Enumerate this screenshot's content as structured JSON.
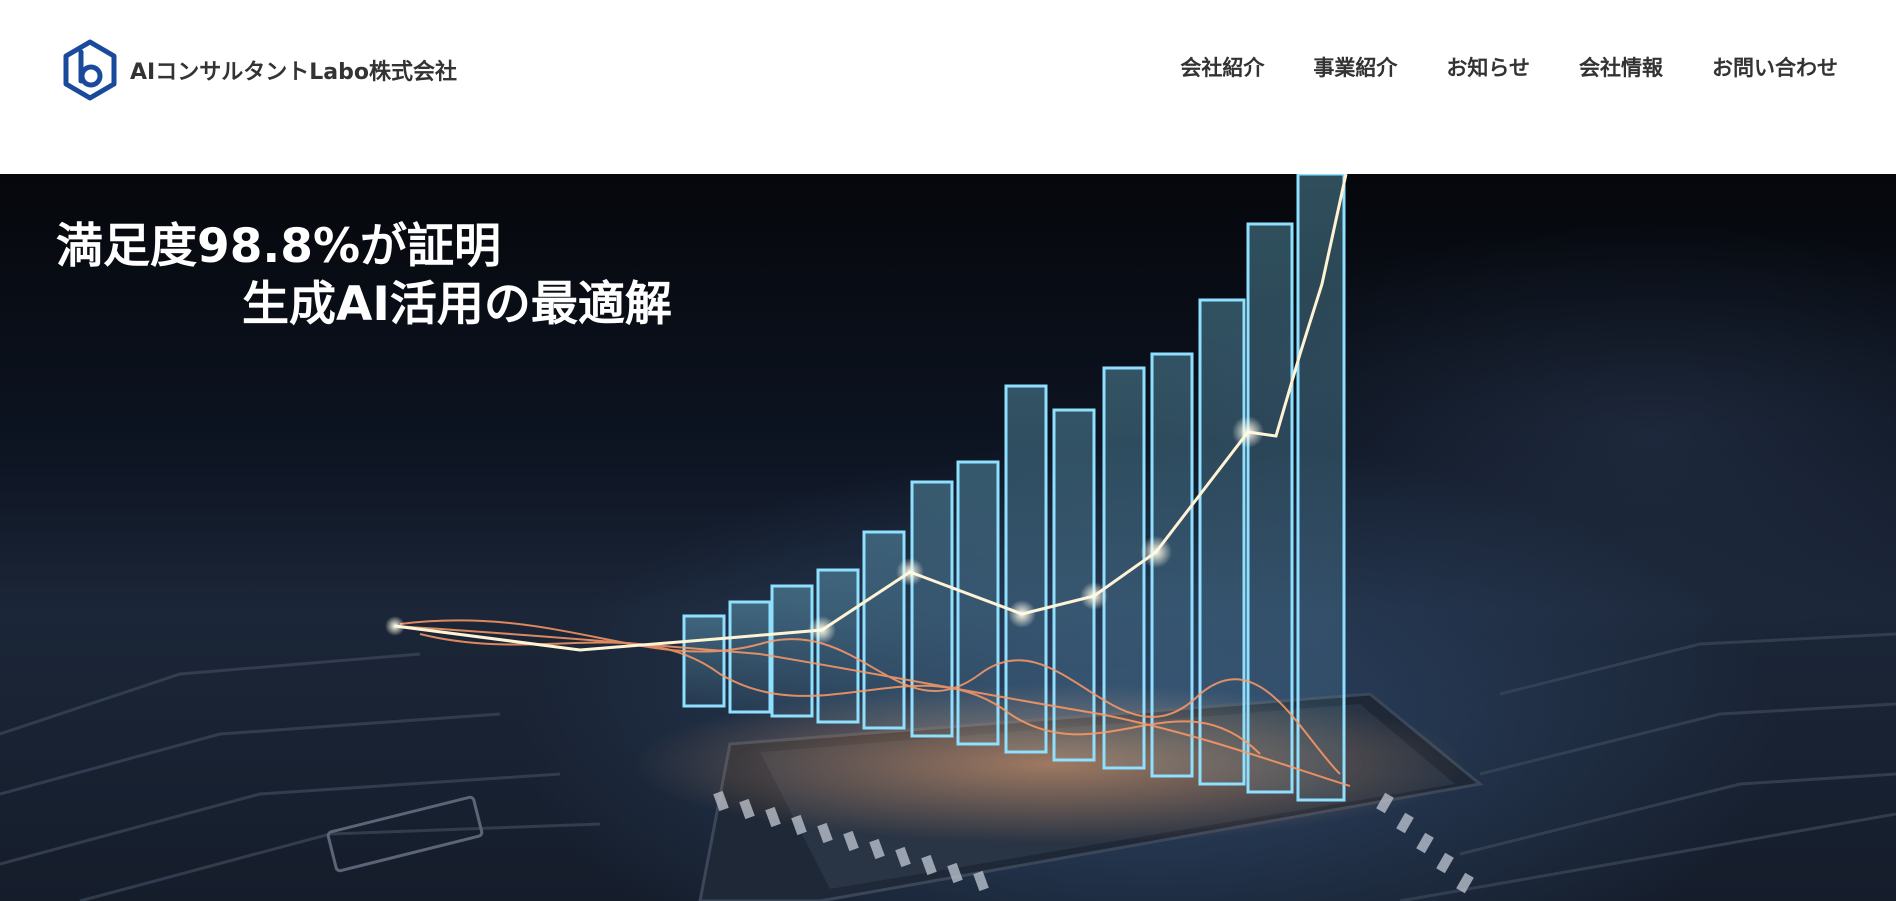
{
  "header": {
    "logo_icon": "hexagon-b-logo-icon",
    "company_name": "AIコンサルタントLabo株式会社",
    "brand_color": "#1a4a9c",
    "nav": [
      {
        "label": "会社紹介"
      },
      {
        "label": "事業紹介"
      },
      {
        "label": "お知らせ"
      },
      {
        "label": "会社情報"
      },
      {
        "label": "お問い合わせ"
      }
    ]
  },
  "hero": {
    "headline_line1": "満足度98.8%が証明",
    "headline_line2": "生成AI活用の最適解",
    "background_image": "glowing-bar-chart-on-circuit-board",
    "accent_colors": {
      "bars": "#7fd3f0",
      "trend_line": "#fff3d6",
      "sparks": "#ff9a66"
    }
  }
}
